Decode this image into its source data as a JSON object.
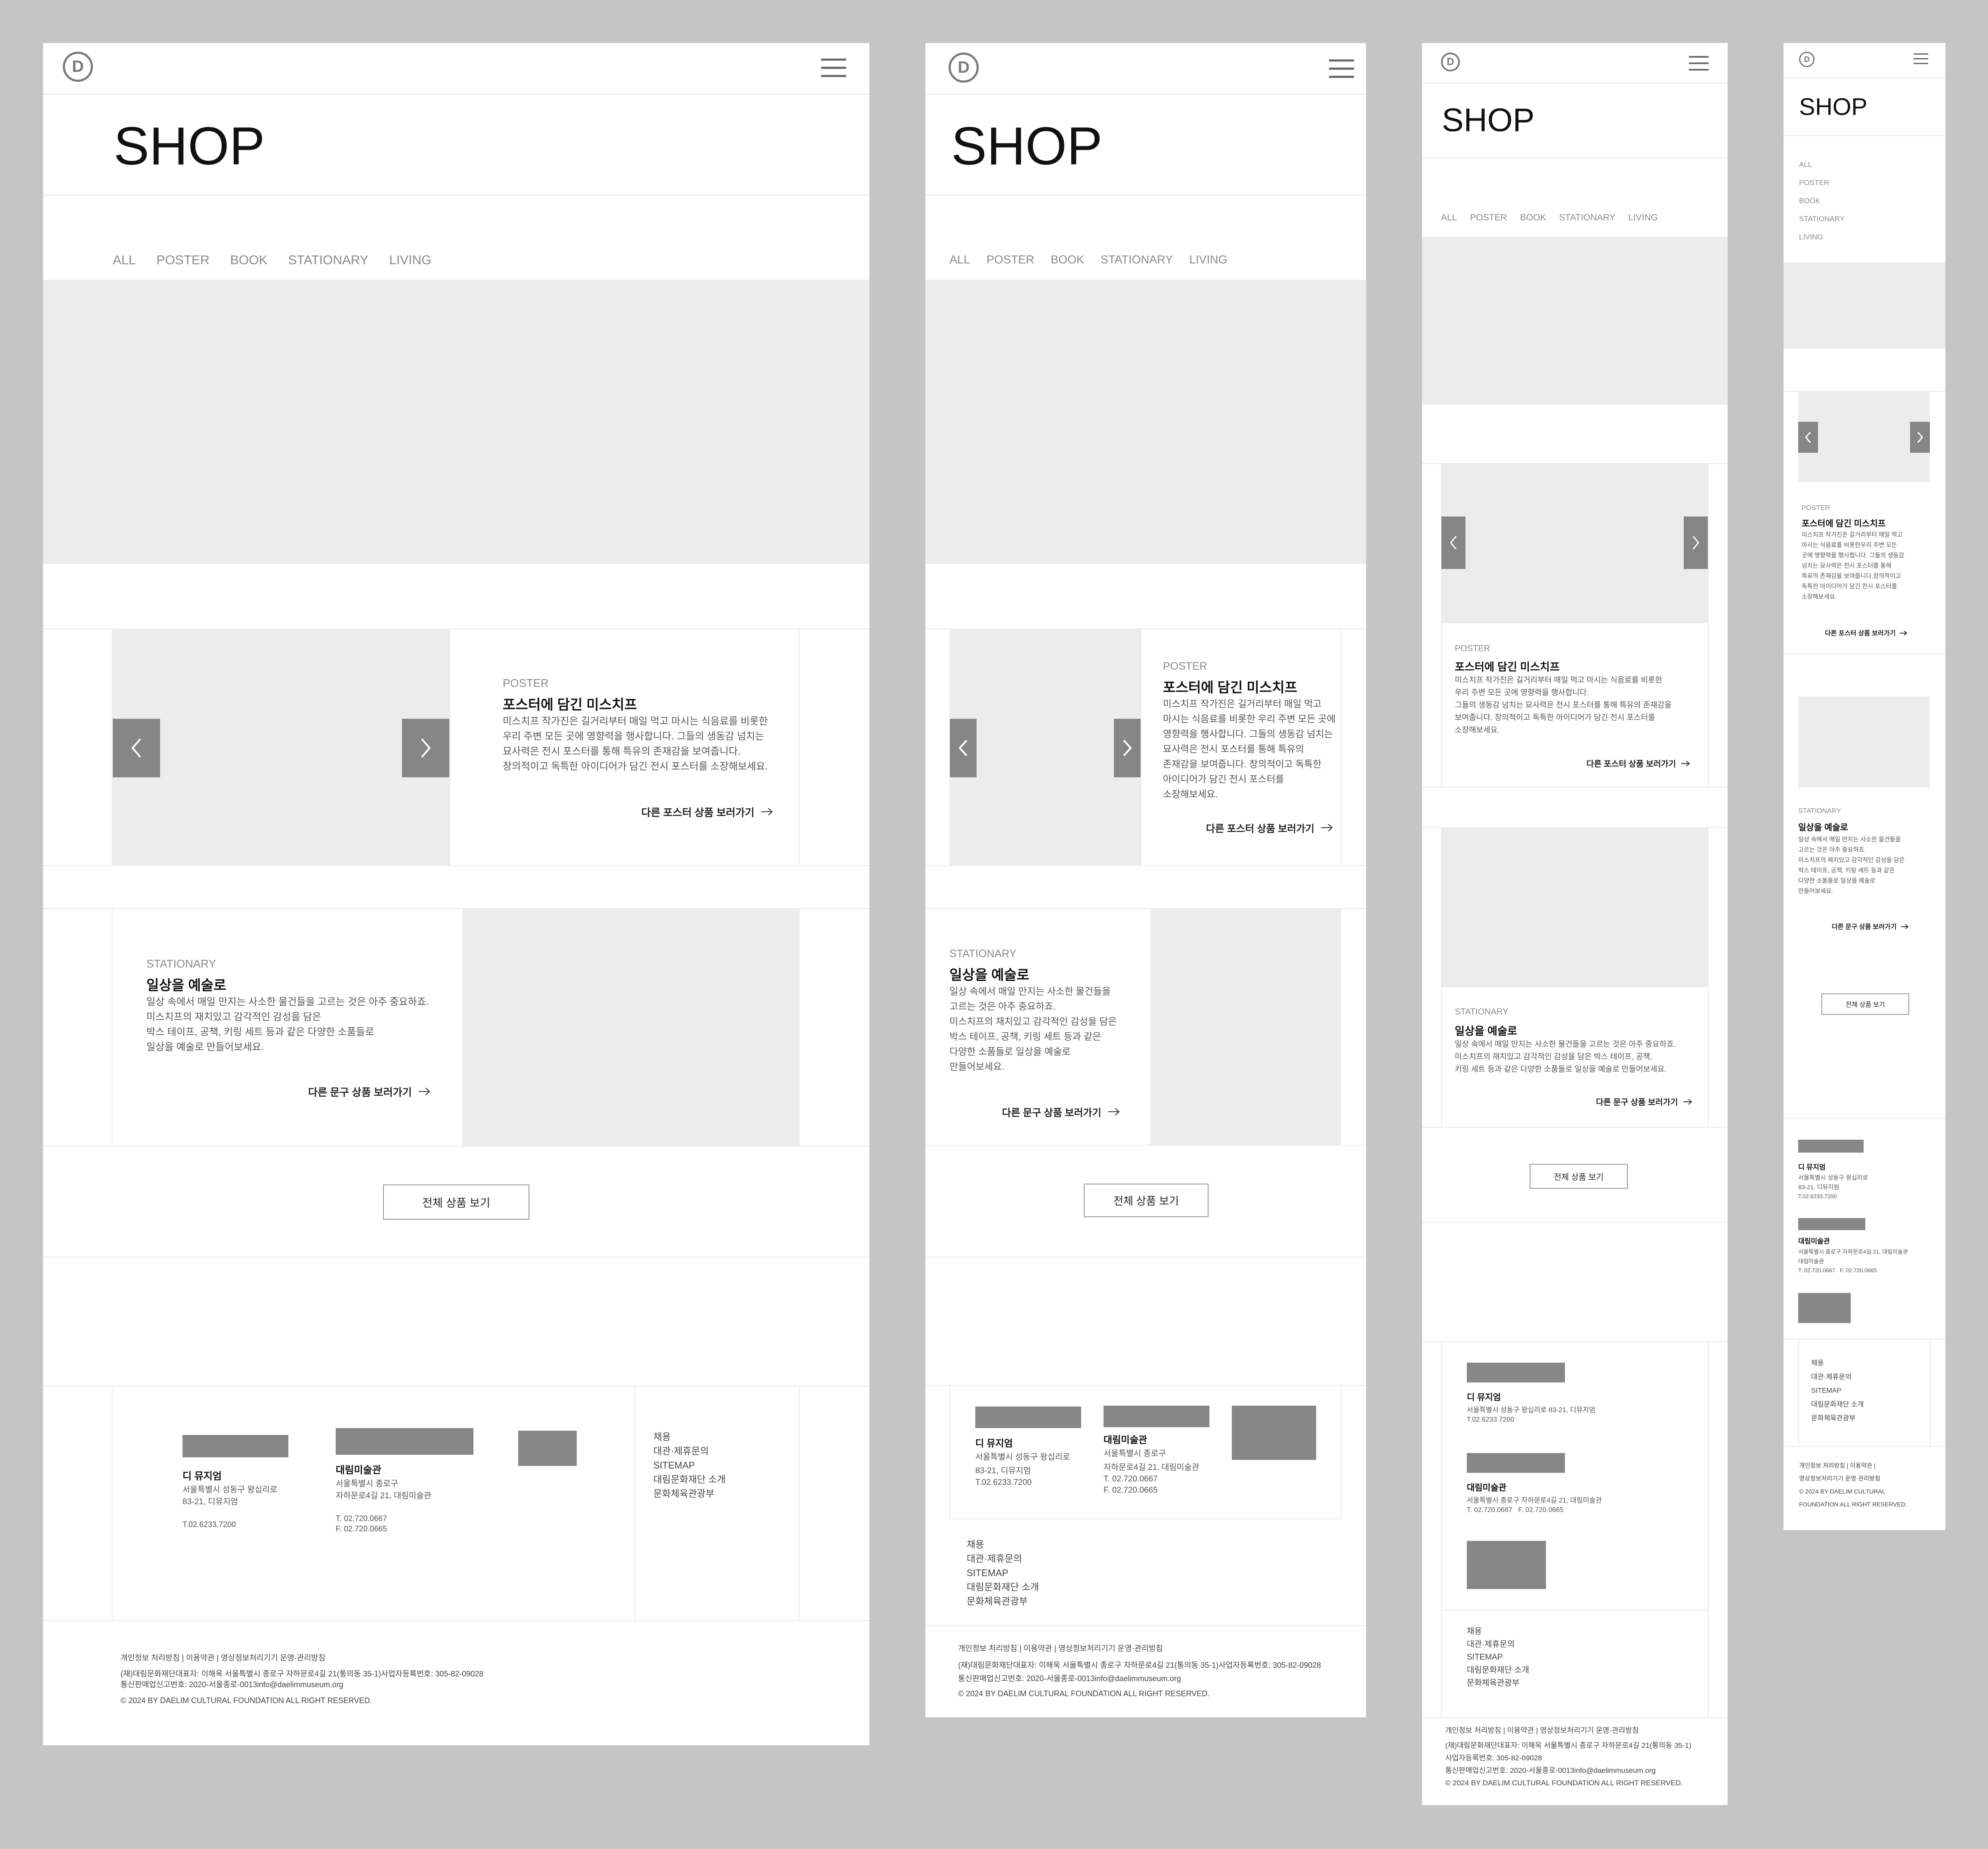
{
  "header": {
    "logo_letter": "D",
    "title": "SHOP"
  },
  "tabs": [
    "ALL",
    "POSTER",
    "BOOK",
    "STATIONARY",
    "LIVING"
  ],
  "poster": {
    "category": "POSTER",
    "title": "포스터에 담긴 미스치프",
    "desc_desktop": "미스치프 작가진은 길거리부터 매일 먹고 마시는 식음료를 비롯한\n우리 주변 모든 곳에 영향력을 행사합니다. 그들의 생동감 넘치는\n묘사력은 전시 포스터를 통해 특유의 존재감을 보여줍니다.\n창의적이고 독특한 아이디어가 담긴 전시 포스터를 소장해보세요.",
    "desc_tablet": "미스치프 작가진은 길거리부터 매일 먹고\n마시는 식음료를 비롯한 우리 주변 모든 곳에\n영향력을 행사합니다. 그들의 생동감 넘치는\n묘사력은 전시 포스터를 통해 특유의\n존재감을 보여줍니다. 창의적이고 독특한\n아이디어가 담긴 전시 포스터를\n소장해보세요.",
    "desc_mobile": "미스치프 작가진은 길거리부터 매일 먹고 마시는 식음료를 비롯한\n우리 주변 모든 곳에 영향력을 행사합니다.\n그들의 생동감 넘치는 묘사력은 전시 포스터를 통해 특유의 존재감을\n보여줍니다. 창의적이고 독특한 아이디어가 담긴 전시 포스터를\n소장해보세요.",
    "desc_small": "미스치프 작가진은 길거리부터 매일 먹고\n마시는 식음료를 비롯한우리 주변 모든\n곳에 영향력을 행사합니다. 그들의 생동감\n넘치는 묘사력은 전시 포스터를 통해\n특유의 존재감을 보여줍니다.창의적이고\n독특한 아이디어가 담긴 전시 포스터를\n소장해보세요.",
    "more": "다른 포스터 상품 보러가기"
  },
  "stationary": {
    "category": "STATIONARY",
    "title": "일상을 예술로",
    "desc_desktop": "일상 속에서 매일 만지는 사소한 물건들을 고르는 것은 아주 중요하죠.\n미스치프의 재치있고 감각적인 감성을 담은\n박스 테이프, 공책, 키링 세트 등과 같은 다양한 소품들로\n일상을 예술로 만들어보세요.",
    "desc_tablet": "일상 속에서 매일 만지는 사소한 물건들을\n고르는 것은 아주 중요하죠.\n미스치프의 재치있고 감각적인 감성을 담은\n박스 테이프, 공책, 키링 세트 등과 같은\n다양한 소품들로 일상을 예술로\n만들어보세요.",
    "desc_mobile": "일상 속에서 매일 만지는 사소한 물건들을 고르는 것은 아주 중요하죠.\n미스치프의 재치있고 감각적인 감성을 담은 박스 테이프, 공책,\n키링 세트 등과 같은 다양한 소품들로 일상을 예술로 만들어보세요.",
    "desc_small": "일상 속에서 매일 만지는 사소한 물건들을\n고르는 것은 아주 중요하죠.\n미스치프의 재치있고 감각적인 감성을 담은\n박스 테이프, 공책, 키링 세트 등과 같은\n다양한 소품들로 일상을 예술로\n만들어보세요.",
    "more": "다른 문구 상품 보러가기"
  },
  "view_all": "전체 상품 보기",
  "footer": {
    "museum1_name": "디 뮤지엄",
    "museum1_addr": "서울특별시 성동구 왕십리로",
    "museum1_addr2": "83-21, 디뮤지엄",
    "museum1_addr_full": "서울특별시 성동구 왕십리로 83-21, 디뮤지엄",
    "museum1_tel": "T.02.6233.7200",
    "museum2_name": "대림미술관",
    "museum2_addr": "서울특별시 종로구",
    "museum2_addr2": "자하문로4길 21, 대림미술관",
    "museum2_addr_full": "서울특별시 종로구 자하문로4길 21, 대림미술관",
    "museum2_tel": "T. 02.720.0667",
    "museum2_fax": "F. 02.720.0665",
    "museum2_tel_fax": "T. 02.720.0667   F. 02.720.0665",
    "links": [
      "채용",
      "대관·제휴문의",
      "SITEMAP",
      "대림문화재단 소개",
      "문화체육관광부"
    ],
    "policy": "개인정보 처리방침 | 이용약관 | 영상정보처리기기 운영·관리방침",
    "policy_a": "개인정보 처리방침 | 이용약관 |",
    "policy_b": "영상정보처리기기 운영·관리방침",
    "company": "(재)대림문화재단대표자: 이해욱 서울특별시 종로구 자하문로4길 21(통의동 35-1)사업자등록번호: 305-82-09028",
    "company_a": "(재)대림문화재단대표자: 이해욱 서울특별시 종로구 자하문로4길 21(통의동 35-1)",
    "company_b": "사업자등록번호: 305-82-09028",
    "mailorder": "통신판매업신고번호: 2020-서울종로-0013info@daelimmuseum.org",
    "copyright": "© 2024 BY DAELIM CULTURAL FOUNDATION ALL RIGHT RESERVED.",
    "copyright_a": "© 2024 BY DAELIM CULTURAL",
    "copyright_b": "FOUNDATION ALL RIGHT RESERVED."
  }
}
